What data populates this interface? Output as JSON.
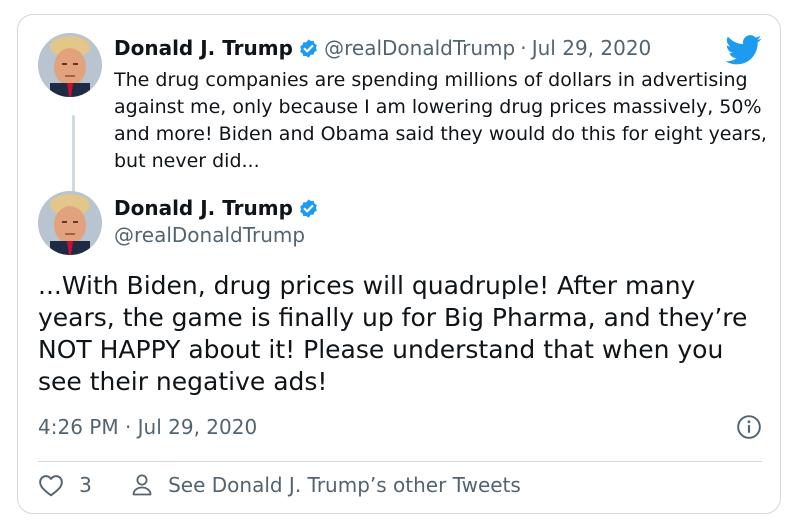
{
  "colors": {
    "text": "#0f1419",
    "muted": "#536471",
    "verified": "#1d9bf0",
    "twitter_blue": "#1d9bf0",
    "border": "#cfd9de"
  },
  "icons": {
    "brand": "twitter-bird-icon",
    "verified": "verified-badge-icon",
    "info": "info-circle-icon",
    "like": "heart-icon",
    "profile": "person-icon"
  },
  "quoted_tweet": {
    "author_name": "Donald J. Trump",
    "handle": "@realDonaldTrump",
    "separator": "·",
    "date": "Jul 29, 2020",
    "text": "The drug companies are spending millions of dollars in advertising against me, only because I am lowering drug prices massively, 50% and more! Biden and Obama said they would do this for eight years, but never did..."
  },
  "main_tweet": {
    "author_name": "Donald J. Trump",
    "handle": "@realDonaldTrump",
    "text": "...With Biden, drug prices will quadruple! After many years, the game is finally up for Big Pharma, and they’re NOT HAPPY about it! Please understand that when you see their negative ads!",
    "timestamp": "4:26 PM · Jul 29, 2020"
  },
  "footer": {
    "like_count": "3",
    "see_more_label": "See Donald J. Trump’s other Tweets"
  }
}
